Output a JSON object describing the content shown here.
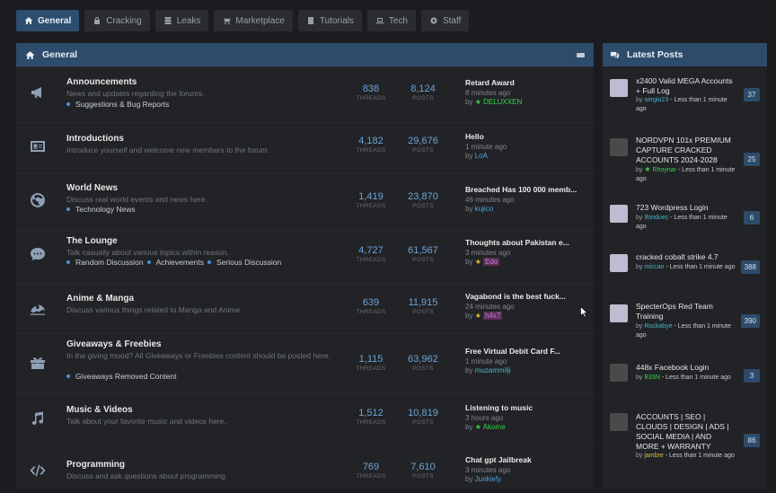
{
  "nav": [
    {
      "label": "General",
      "icon": "home-icon",
      "active": true
    },
    {
      "label": "Cracking",
      "icon": "lock-icon"
    },
    {
      "label": "Leaks",
      "icon": "database-icon"
    },
    {
      "label": "Marketplace",
      "icon": "cart-icon"
    },
    {
      "label": "Tutorials",
      "icon": "book-icon"
    },
    {
      "label": "Tech",
      "icon": "laptop-icon"
    },
    {
      "label": "Staff",
      "icon": "gear-icon"
    }
  ],
  "main": {
    "title": "General",
    "threads_label": "THREADS",
    "posts_label": "POSTS",
    "forums": [
      {
        "title": "Announcements",
        "desc": "News and updates regarding the forums.",
        "subs": [
          "Suggestions & Bug Reports"
        ],
        "threads": "838",
        "posts": "8,124",
        "last_title": "Retard Award",
        "last_time": "8 minutes ago",
        "last_by": "by",
        "last_user": "DELUXXEN",
        "icon": "megaphone-icon"
      },
      {
        "title": "Introductions",
        "desc": "Introduce yourself and welcome new members to the forum.",
        "subs": [],
        "threads": "4,182",
        "posts": "29,676",
        "last_title": "Hello",
        "last_time": "1 minute ago",
        "last_by": "by",
        "last_user": "LoA",
        "icon": "id-card-icon"
      },
      {
        "title": "World News",
        "desc": "Discuss real world events and news here.",
        "subs": [
          "Technology News"
        ],
        "threads": "1,419",
        "posts": "23,870",
        "last_title": "Breached Has 100 000 memb...",
        "last_time": "46 minutes ago",
        "last_by": "by",
        "last_user": "kujico",
        "icon": "globe-icon"
      },
      {
        "title": "The Lounge",
        "desc": "Talk casually about various topics within reason.",
        "subs": [
          "Random Discussion",
          "Achievements",
          "Serious Discussion"
        ],
        "threads": "4,727",
        "posts": "61,567",
        "last_title": "Thoughts about Pakistan e...",
        "last_time": "3 minutes ago",
        "last_by": "by",
        "last_user": "Edo",
        "icon": "chat-icon"
      },
      {
        "title": "Anime & Manga",
        "desc": "Discuss various things related to Manga and Anime.",
        "subs": [],
        "threads": "639",
        "posts": "11,915",
        "last_title": "Vagabond is the best fuck...",
        "last_time": "24 minutes ago",
        "last_by": "by",
        "last_user": "h4x7",
        "icon": "wave-icon"
      },
      {
        "title": "Giveaways & Freebies",
        "desc": "In the giving mood? All Giveaways or Freebies content should be posted here.",
        "subs": [
          "Giveaways Removed Content"
        ],
        "threads": "1,115",
        "posts": "63,962",
        "last_title": "Free Virtual Debit Card F...",
        "last_time": "1 minute ago",
        "last_by": "by",
        "last_user": "muzammilji",
        "icon": "gift-icon"
      },
      {
        "title": "Music & Videos",
        "desc": "Talk about your favorite music and videos here.",
        "subs": [],
        "threads": "1,512",
        "posts": "10,819",
        "last_title": "Listening to music",
        "last_time": "3 hours ago",
        "last_by": "by",
        "last_user": "Akome",
        "icon": "music-icon"
      },
      {
        "title": "Programming",
        "desc": "Discuss and ask questions about programming.",
        "subs": [],
        "threads": "769",
        "posts": "7,610",
        "last_title": "Chat gpt Jailbreak",
        "last_time": "3 minutes ago",
        "last_by": "by",
        "last_user": "Junkiefy",
        "icon": "code-icon"
      }
    ]
  },
  "side": {
    "title": "Latest Posts",
    "posts": [
      {
        "title": "x2400 Valid MEGA Accounts + Full Log",
        "by": "by",
        "user": "sergio23",
        "time": "- Less than 1 minute ago",
        "count": "37"
      },
      {
        "title": "NORDVPN 101x PREMIUM CAPTURE CRACKED ACCOUNTS 2024-2028",
        "by": "by",
        "user": "Rhoynar",
        "time": "- Less than 1 minute ago",
        "count": "25"
      },
      {
        "title": "723 Wordpress Login",
        "by": "by",
        "user": "Ifonduec",
        "time": "- Less than 1 minute ago",
        "count": "6"
      },
      {
        "title": "cracked cobalt strike 4.7",
        "by": "by",
        "user": "miccan",
        "time": "- Less than 1 minute ago",
        "count": "388"
      },
      {
        "title": "SpecterOps Red Team Training",
        "by": "by",
        "user": "Rockabye",
        "time": "- Less than 1 minute ago",
        "count": "390"
      },
      {
        "title": "448x Facebook Login",
        "by": "by",
        "user": "B33N",
        "time": "- Less than 1 minute ago",
        "count": "3"
      },
      {
        "title": "ACCOUNTS | SEO | CLOUDS | DESIGN | ADS | SOCIAL MEDIA | AND MORE + WARRANTY",
        "by": "by",
        "user": "jambre",
        "time": "- Less than 1 minute ago",
        "count": "86"
      }
    ]
  }
}
